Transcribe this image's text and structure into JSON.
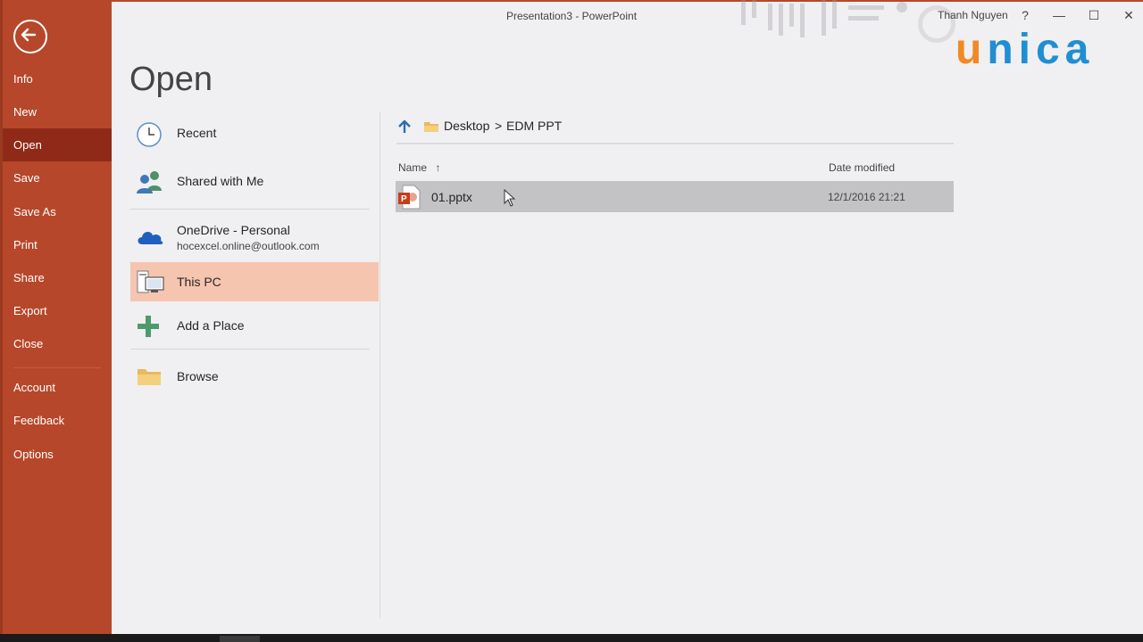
{
  "window": {
    "title": "Presentation3  -  PowerPoint",
    "user": "Thanh Nguyen",
    "help_label": "?",
    "minimize_label": "—",
    "maximize_label": "☐",
    "close_label": "✕"
  },
  "logo": {
    "u": "u",
    "rest": "nica"
  },
  "colors": {
    "accent": "#b7472a",
    "active_nav": "#8f2a18",
    "selected_location": "#f6c5af",
    "selected_file": "#c3c2c5"
  },
  "sidebar": {
    "items": [
      {
        "label": "Info"
      },
      {
        "label": "New"
      },
      {
        "label": "Open"
      },
      {
        "label": "Save"
      },
      {
        "label": "Save As"
      },
      {
        "label": "Print"
      },
      {
        "label": "Share"
      },
      {
        "label": "Export"
      },
      {
        "label": "Close"
      },
      {
        "label": "Account"
      },
      {
        "label": "Feedback"
      },
      {
        "label": "Options"
      }
    ],
    "active": "Open"
  },
  "page": {
    "title": "Open"
  },
  "locations": {
    "recent": {
      "label": "Recent",
      "icon": "clock-icon"
    },
    "shared": {
      "label": "Shared with Me",
      "icon": "people-icon"
    },
    "onedrive": {
      "label": "OneDrive - Personal",
      "account": "hocexcel.online@outlook.com",
      "icon": "onedrive-icon"
    },
    "this_pc": {
      "label": "This PC",
      "icon": "computer-icon"
    },
    "add_place": {
      "label": "Add a Place",
      "icon": "plus-icon"
    },
    "browse": {
      "label": "Browse",
      "icon": "folder-icon"
    }
  },
  "browser": {
    "path": {
      "part1": "Desktop",
      "separator": ">",
      "part2": "EDM PPT"
    },
    "columns": {
      "name": "Name",
      "sort_arrow": "↑",
      "date": "Date modified"
    },
    "files": [
      {
        "name": "01.pptx",
        "date": "12/1/2016 21:21",
        "icon": "pptx-file-icon"
      }
    ]
  }
}
